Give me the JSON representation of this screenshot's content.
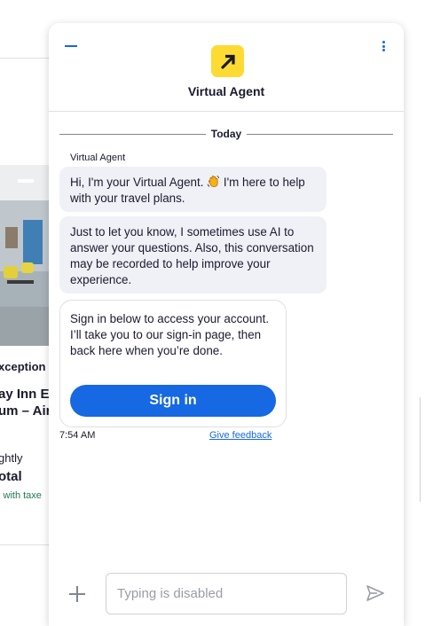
{
  "background": {
    "exception_text": "xception",
    "hotel_name_line1": "ay Inn Ex",
    "hotel_name_line2": "um – Air",
    "nightly": "ghtly",
    "total": "otal",
    "taxes": "l with taxe"
  },
  "header": {
    "title": "Virtual Agent",
    "minimize_icon": "minimize-icon",
    "more_icon": "more-vertical-icon",
    "logo_icon": "brand-arrow-logo"
  },
  "conversation": {
    "date_label": "Today",
    "sender": "Virtual Agent",
    "messages": [
      {
        "text_before_icon": "Hi, I'm your Virtual Agent.",
        "icon": "waving-hand-icon",
        "text_after_icon": " I'm here to help with your travel plans."
      },
      {
        "text": "Just to let you know, I sometimes use AI to answer your questions. Also, this conversation may be recorded to help improve your experience."
      }
    ],
    "signin_card": {
      "text": "Sign in below to access your account. I’ll take you to our sign-in page, then back here when you’re done.",
      "button_label": "Sign in"
    },
    "timestamp": "7:54 AM",
    "feedback_label": "Give feedback"
  },
  "composer": {
    "placeholder": "Typing is disabled",
    "add_icon": "plus-icon",
    "send_icon": "send-icon"
  },
  "colors": {
    "accent": "#1668e3",
    "brand_yellow": "#fddb32",
    "bubble_bg": "#eff1f6",
    "text": "#1a1a2e"
  }
}
